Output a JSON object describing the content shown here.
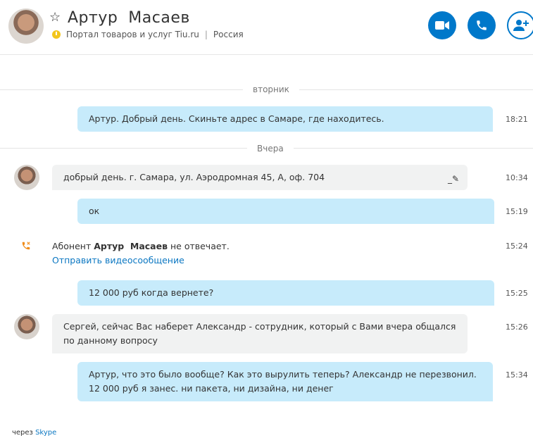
{
  "header": {
    "name": "Артур  Масаев",
    "subtitle": "Портал товаров и услуг Tiu.ru",
    "separator": "|",
    "location": "Россия",
    "buttons": [
      "video-call",
      "voice-call",
      "add-contact"
    ]
  },
  "day_labels": {
    "tuesday": "вторник",
    "yesterday": "Вчера"
  },
  "messages": [
    {
      "dir": "out",
      "text": "Артур. Добрый день. Скиньте адрес в Самаре, где находитесь.",
      "time": "18:21"
    },
    {
      "dir": "in",
      "text": "добрый день. г. Самара, ул. Аэродромная 45, А, оф. 704",
      "time": "10:34"
    },
    {
      "dir": "out",
      "text": "ок",
      "time": "15:19"
    },
    {
      "dir": "out",
      "text": "12 000 руб когда вернете?",
      "time": "15:25"
    },
    {
      "dir": "in",
      "text": "Сергей, сейчас Вас наберет Александр - сотрудник, который с Вами вчера общался по данному вопросу",
      "time": "15:26"
    },
    {
      "dir": "out",
      "text": "Артур, что это было вообще? Как это вырулить теперь? Александр не перезвонил. 12 000 руб я занес. ни пакета, ни дизайна, ни денег",
      "time": "15:34"
    }
  ],
  "missed_call": {
    "prefix": "Абонент",
    "name": "Артур  Масаев",
    "suffix": "не отвечает.",
    "link": "Отправить видеосообщение",
    "time": "15:24"
  },
  "footer": {
    "via": "через",
    "brand": "Skype"
  },
  "colors": {
    "accent": "#0078ca",
    "bubble_out": "#c7ebfb",
    "bubble_in": "#f1f2f2",
    "link": "#0b77c2",
    "status": "#f3c61d",
    "missed_call_icon": "#f08c1a"
  }
}
